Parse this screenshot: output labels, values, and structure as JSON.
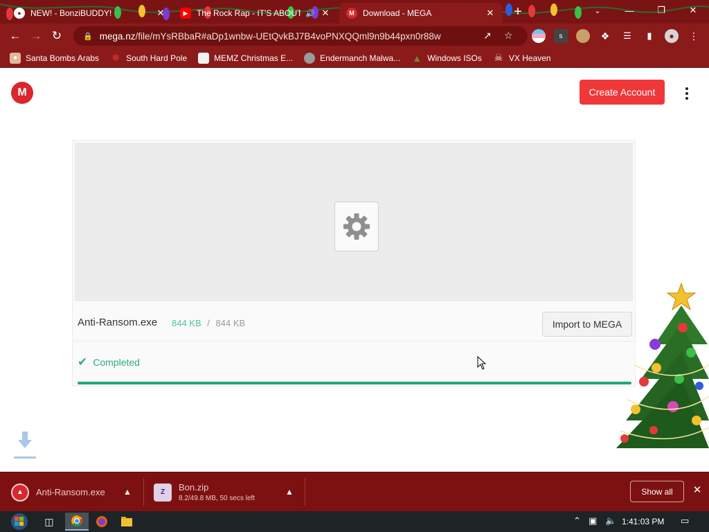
{
  "browser": {
    "tabs": [
      {
        "title": "NEW! - BonziBUDDY!",
        "favicon": "globe-icon",
        "active": false
      },
      {
        "title": "The Rock Rap - IT'S ABOUT",
        "favicon": "youtube-icon",
        "active": false,
        "audio": true
      },
      {
        "title": "Download - MEGA",
        "favicon": "mega-icon",
        "active": true
      }
    ],
    "new_tab_label": "+",
    "address": {
      "host": "mega.nz",
      "path": "/file/mYsRBbaR#aDp1wnbw-UEtQvkBJ7B4voPNXQQml9n9b44pxn0r88w"
    },
    "bookmarks": [
      {
        "label": "Santa Bombs Arabs",
        "icon": "santa-icon"
      },
      {
        "label": "South Hard Pole",
        "icon": "snowflake-icon"
      },
      {
        "label": "MEMZ Christmas E...",
        "icon": "page-icon"
      },
      {
        "label": "Endermanch Malwa...",
        "icon": "raccoon-icon"
      },
      {
        "label": "Windows ISOs",
        "icon": "tree-icon"
      },
      {
        "label": "VX Heaven",
        "icon": "skull-icon"
      }
    ],
    "theme_color": "#8b1a1a"
  },
  "mega": {
    "logo_letter": "M",
    "create_account_label": "Create Account",
    "file": {
      "name": "Anti-Ransom.exe",
      "downloaded": "844 KB",
      "separator": "/",
      "total": "844 KB"
    },
    "import_label": "Import to MEGA",
    "status_label": "Completed",
    "progress_fraction": 1.0,
    "brand_color": "#d9272e",
    "success_color": "#1fa87a"
  },
  "downloads": {
    "items": [
      {
        "name": "Anti-Ransom.exe",
        "detail": "",
        "icon": "mega-file-icon"
      },
      {
        "name": "Bon.zip",
        "detail": "8.2/49.8 MB, 50 secs left",
        "icon": "zip-icon"
      }
    ],
    "show_all_label": "Show all"
  },
  "taskbar": {
    "time": "1:41:03 PM"
  }
}
